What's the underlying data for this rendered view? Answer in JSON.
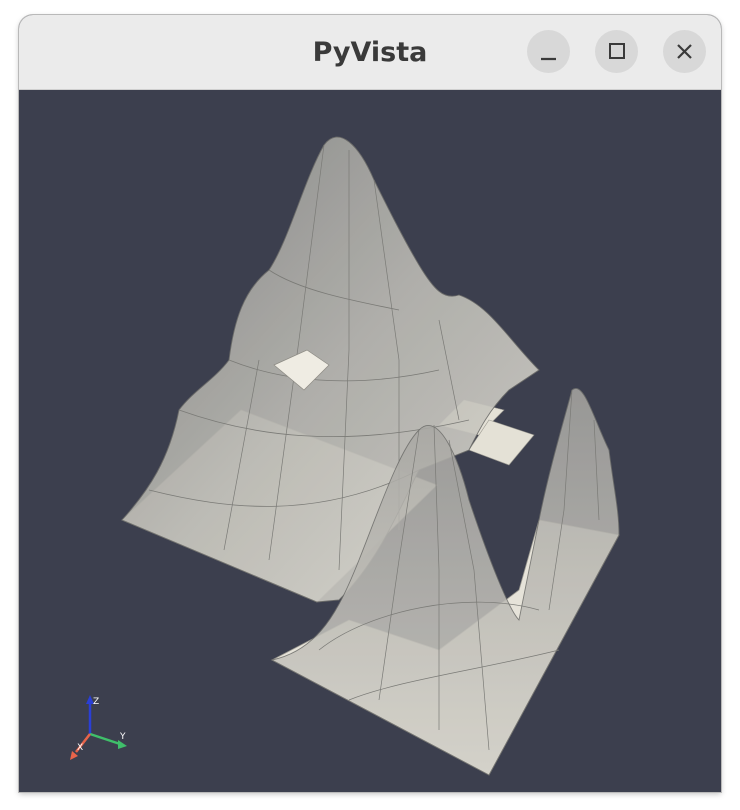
{
  "window": {
    "title": "PyVista",
    "controls": [
      "minimize",
      "maximize",
      "close"
    ]
  },
  "viewport": {
    "background_color": "#3c3f4e",
    "mesh_color": "#d9d6cc",
    "axes": {
      "x_label": "X",
      "y_label": "Y",
      "z_label": "Z",
      "x_color": "#e8644a",
      "y_color": "#3fbf6a",
      "z_color": "#2a3fd6"
    }
  }
}
